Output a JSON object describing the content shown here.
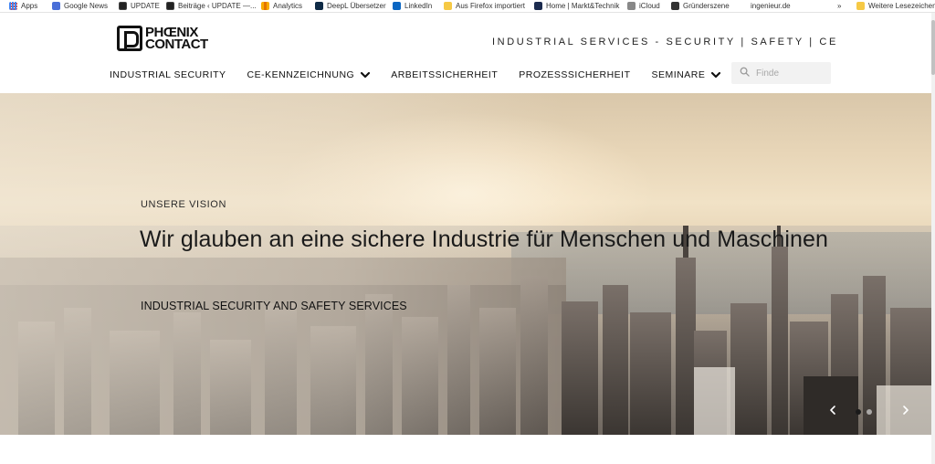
{
  "bookmarks": [
    {
      "label": "Apps",
      "icon": "apps-icon"
    },
    {
      "label": "Google News",
      "icon": "google-news-icon"
    },
    {
      "label": "UPDATE",
      "icon": "update-icon"
    },
    {
      "label": "Beiträge ‹ UPDATE —...",
      "icon": "update-icon"
    },
    {
      "label": "Analytics",
      "icon": "analytics-icon"
    },
    {
      "label": "DeepL Übersetzer",
      "icon": "deepl-icon"
    },
    {
      "label": "LinkedIn",
      "icon": "linkedin-icon"
    },
    {
      "label": "Aus Firefox importiert",
      "icon": "folder-icon"
    },
    {
      "label": "Home | Markt&Technik",
      "icon": "markt-technik-icon"
    },
    {
      "label": "iCloud",
      "icon": "apple-icon"
    },
    {
      "label": "Gründerszene",
      "icon": "gruenderszene-icon"
    },
    {
      "label": "ingenieur.de",
      "icon": "ingenieur-icon"
    }
  ],
  "bookmarks_overflow": "»",
  "other_bookmarks": "Weitere Lesezeichen",
  "logo": {
    "line1": "PHŒNIX",
    "line2": "CONTACT"
  },
  "tagline": "INDUSTRIAL SERVICES - SECURITY | SAFETY | CE",
  "nav": [
    {
      "label": "INDUSTRIAL SECURITY",
      "dropdown": false
    },
    {
      "label": "CE-KENNZEICHNUNG",
      "dropdown": true
    },
    {
      "label": "ARBEITSSICHERHEIT",
      "dropdown": false
    },
    {
      "label": "PROZESSSICHERHEIT",
      "dropdown": false
    },
    {
      "label": "SEMINARE",
      "dropdown": true
    }
  ],
  "search": {
    "placeholder": "Finde",
    "value": ""
  },
  "hero": {
    "eyebrow": "UNSERE VISION",
    "headline": "Wir glauben an eine sichere Industrie für Menschen und Maschinen",
    "subline": "INDUSTRIAL SECURITY AND SAFETY SERVICES",
    "slides": 2,
    "active_slide": 0
  },
  "colors": {
    "accent": "#111111",
    "search_bg": "#f2f2f2",
    "dot_active": "#1a1a1a"
  }
}
